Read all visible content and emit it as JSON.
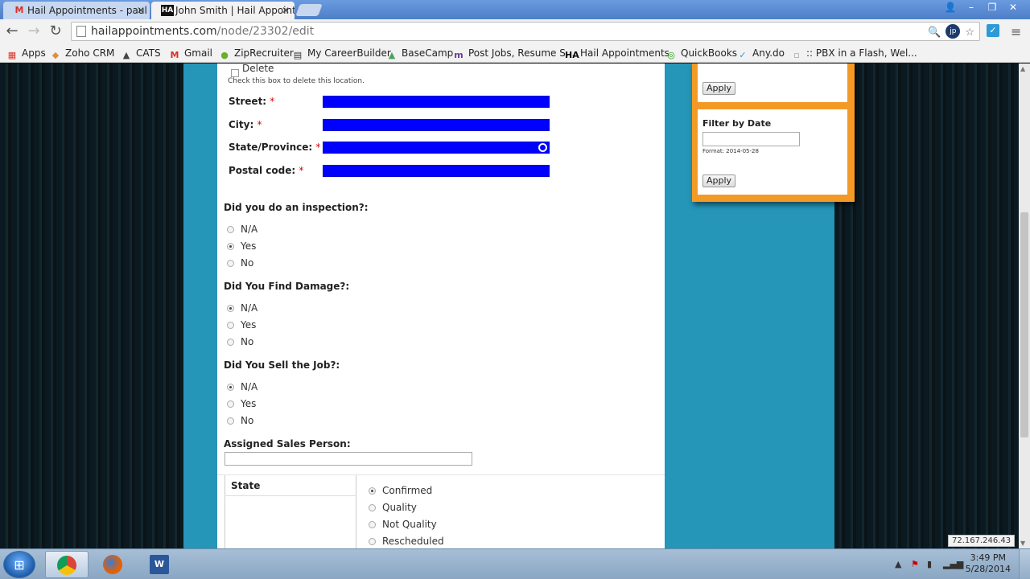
{
  "tabs": [
    {
      "label": "Hail Appointments - paul",
      "icon": "gmail-icon",
      "active": false
    },
    {
      "label": "John Smith | Hail Appoint",
      "icon": "hail-appointments-icon",
      "active": true
    }
  ],
  "toolbar": {
    "url_domain": "hailappointments.com",
    "url_path": "/node/23302/edit"
  },
  "bookmarks": [
    {
      "label": "Apps",
      "icon": "apps-grid-icon",
      "color": "#d9352b"
    },
    {
      "label": "Zoho CRM",
      "icon": "zoho-icon",
      "color": "#e0922c"
    },
    {
      "label": "CATS",
      "icon": "cats-icon",
      "color": "#444444"
    },
    {
      "label": "Gmail",
      "icon": "gmail-icon",
      "color": "#d93025"
    },
    {
      "label": "ZipRecruiter",
      "icon": "ziprecruiter-icon",
      "color": "#6ab023"
    },
    {
      "label": "My CareerBuilder",
      "icon": "careerbuilder-icon",
      "color": "#333333"
    },
    {
      "label": "BaseCamp",
      "icon": "basecamp-icon",
      "color": "#4aa35c"
    },
    {
      "label": "Post Jobs, Resume S...",
      "icon": "monster-icon",
      "color": "#6a3c97"
    },
    {
      "label": "Hail Appointments",
      "icon": "hail-appointments-icon",
      "color": "#111111"
    },
    {
      "label": "QuickBooks",
      "icon": "quickbooks-icon",
      "color": "#2ca01c"
    },
    {
      "label": "Any.do",
      "icon": "anydo-icon",
      "color": "#2a9bd8"
    },
    {
      "label": ":: PBX in a Flash, Wel...",
      "icon": "pbx-icon",
      "color": "#999999"
    }
  ],
  "form": {
    "delete_label": "Delete",
    "delete_help": "Check this box to delete this location.",
    "street_label": "Street:",
    "city_label": "City:",
    "state_label": "State/Province:",
    "postal_label": "Postal code:",
    "required_mark": "*",
    "inspection": {
      "question": "Did you do an inspection?:",
      "options": [
        {
          "label": "N/A",
          "checked": false
        },
        {
          "label": "Yes",
          "checked": true
        },
        {
          "label": "No",
          "checked": false
        }
      ]
    },
    "damage": {
      "question": "Did You Find Damage?:",
      "options": [
        {
          "label": "N/A",
          "checked": true
        },
        {
          "label": "Yes",
          "checked": false
        },
        {
          "label": "No",
          "checked": false
        }
      ]
    },
    "sold": {
      "question": "Did You Sell the Job?:",
      "options": [
        {
          "label": "N/A",
          "checked": true
        },
        {
          "label": "Yes",
          "checked": false
        },
        {
          "label": "No",
          "checked": false
        }
      ]
    },
    "sales_person_label": "Assigned Sales Person:",
    "sales_person_value": "",
    "state_header": "State",
    "state_options": [
      {
        "label": "Confirmed",
        "checked": true
      },
      {
        "label": "Quality",
        "checked": false
      },
      {
        "label": "Not Quality",
        "checked": false
      },
      {
        "label": "Rescheduled",
        "checked": false
      }
    ]
  },
  "sidebar": {
    "apply_label": "Apply",
    "filter_date_title": "Filter by Date",
    "filter_date_value": "",
    "format_hint": "Format: 2014-05-28",
    "apply_label_2": "Apply"
  },
  "status": {
    "ip": "72.167.246.43"
  },
  "taskbar": {
    "time": "3:49 PM",
    "date": "5/28/2014",
    "apps": [
      {
        "name": "chrome-icon",
        "active": true
      },
      {
        "name": "firefox-icon",
        "active": false
      },
      {
        "name": "word-icon",
        "active": false
      }
    ]
  },
  "colors": {
    "teal_bg": "#2596b8",
    "orange_panel": "#f39a26",
    "blue_field": "#0000ff",
    "required": "#dd0000"
  }
}
